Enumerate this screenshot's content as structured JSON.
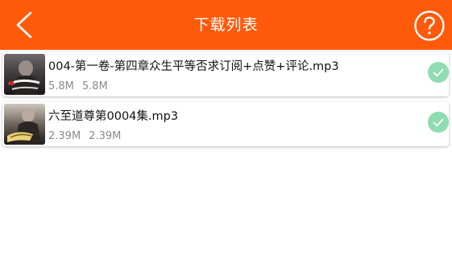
{
  "header": {
    "title": "下载列表",
    "back_icon": "chevron-left-icon",
    "help_icon": "question-circle-icon",
    "color": "#ff5a0a"
  },
  "downloads": [
    {
      "name": "004-第一卷-第四章众生平等否求订阅+点赞+评论.mp3",
      "downloaded": "5.8M",
      "total": "5.8M",
      "status_icon": "check-circle-icon"
    },
    {
      "name": "六至道尊第0004集.mp3",
      "downloaded": "2.39M",
      "total": "2.39M",
      "status_icon": "check-circle-icon"
    }
  ],
  "colors": {
    "check": "#8fdcb2",
    "text_primary": "#111111",
    "text_secondary": "#8a8a8a"
  }
}
